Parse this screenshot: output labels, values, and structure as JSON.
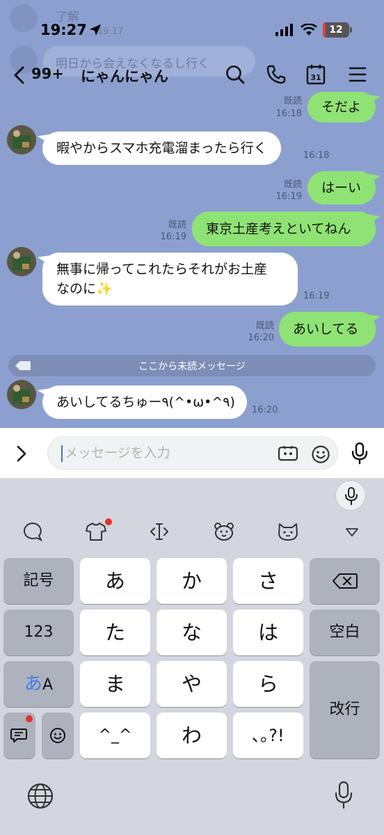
{
  "status": {
    "time": "19:27",
    "battery": "12"
  },
  "background_ghost": {
    "line1": "了解",
    "line1_time": "19:17",
    "line2": "明日から会えなくなるし行く"
  },
  "header": {
    "unread_count": "99+",
    "title": "にゃんにゃん"
  },
  "messages": [
    {
      "side": "right",
      "text": "そだよ",
      "read": "既読",
      "time": "16:18"
    },
    {
      "side": "left",
      "text": "暇やからスマホ充電溜まったら行く",
      "time": "16:18"
    },
    {
      "side": "right",
      "text": "はーい",
      "read": "既読",
      "time": "16:19"
    },
    {
      "side": "right",
      "text": "東京土産考えといてねん",
      "read": "既読",
      "time": "16:19"
    },
    {
      "side": "left",
      "text": "無事に帰ってこれたらそれがお土産",
      "text2": "なのに✨",
      "time": "16:19"
    },
    {
      "side": "right",
      "text": "あいしてる",
      "read": "既読",
      "time": "16:20"
    },
    {
      "side": "left",
      "text": "あいしてるちゅー٩(^•ω•^٩)",
      "time": "16:20"
    }
  ],
  "unread_divider": "ここから未読メッセージ",
  "input": {
    "placeholder": "メッセージを入力"
  },
  "keyboard": {
    "keys": {
      "symbols": "記号",
      "a": "あ",
      "ka": "か",
      "sa": "さ",
      "num": "123",
      "ta": "た",
      "na": "な",
      "ha": "は",
      "space": "空白",
      "mode_a": "あ",
      "mode_A": "A",
      "ma": "ま",
      "ya": "や",
      "ra": "ら",
      "enter": "改行",
      "kaomoji": "^_^",
      "wa": "わ",
      "punct": "､｡?!"
    }
  },
  "colors": {
    "chat_bg": "#8ca0d0",
    "my_bubble": "#8fe374",
    "keyboard_bg": "#d3d6de",
    "badge": "#e2302c"
  }
}
